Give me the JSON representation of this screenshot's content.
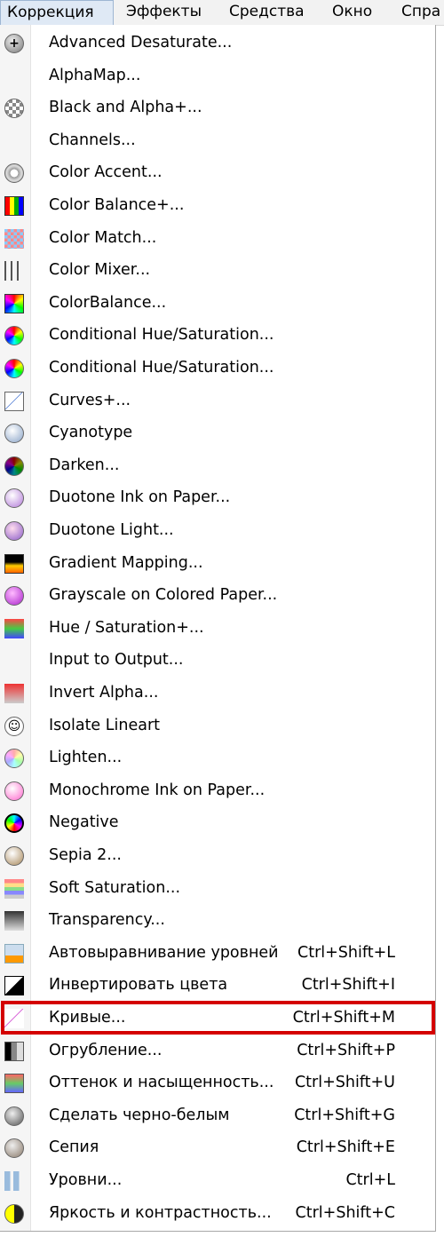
{
  "menubar": [
    {
      "label": "Коррекция",
      "active": true
    },
    {
      "label": "Эффекты",
      "active": false
    },
    {
      "label": "Средства",
      "active": false
    },
    {
      "label": "Окно",
      "active": false
    },
    {
      "label": "Спра",
      "active": false
    }
  ],
  "items": [
    {
      "label": "Advanced Desaturate...",
      "shortcut": "",
      "icon": "gray-plus-circle-icon"
    },
    {
      "label": "AlphaMap...",
      "shortcut": "",
      "icon": ""
    },
    {
      "label": "Black and Alpha+...",
      "shortcut": "",
      "icon": "checkered-circle-icon"
    },
    {
      "label": "Channels...",
      "shortcut": "",
      "icon": ""
    },
    {
      "label": "Color Accent...",
      "shortcut": "",
      "icon": "gray-ring-icon"
    },
    {
      "label": "Color Balance+...",
      "shortcut": "",
      "icon": "color-grid-icon"
    },
    {
      "label": "Color Match...",
      "shortcut": "",
      "icon": "color-dots-icon"
    },
    {
      "label": "Color Mixer...",
      "shortcut": "",
      "icon": "mixer-sliders-icon"
    },
    {
      "label": "ColorBalance...",
      "shortcut": "",
      "icon": "hourglass-gradient-icon"
    },
    {
      "label": "Conditional Hue/Saturation...",
      "shortcut": "",
      "icon": "color-wheel-icon"
    },
    {
      "label": "Conditional Hue/Saturation...",
      "shortcut": "",
      "icon": "color-wheel-icon"
    },
    {
      "label": "Curves+...",
      "shortcut": "",
      "icon": "curves-plus-icon"
    },
    {
      "label": "Cyanotype",
      "shortcut": "",
      "icon": "blue-gray-circle-icon"
    },
    {
      "label": "Darken...",
      "shortcut": "",
      "icon": "dark-wheel-icon"
    },
    {
      "label": "Duotone Ink on Paper...",
      "shortcut": "",
      "icon": "purple-circle-icon"
    },
    {
      "label": "Duotone Light...",
      "shortcut": "",
      "icon": "violet-circle-icon"
    },
    {
      "label": "Gradient Mapping...",
      "shortcut": "",
      "icon": "gradient-square-icon"
    },
    {
      "label": "Grayscale on Colored Paper...",
      "shortcut": "",
      "icon": "magenta-circle-icon"
    },
    {
      "label": "Hue / Saturation+...",
      "shortcut": "",
      "icon": "hue-square-icon"
    },
    {
      "label": "Input to Output...",
      "shortcut": "",
      "icon": ""
    },
    {
      "label": "Invert Alpha...",
      "shortcut": "",
      "icon": "red-fade-square-icon"
    },
    {
      "label": "Isolate Lineart",
      "shortcut": "",
      "icon": "smiley-icon"
    },
    {
      "label": "Lighten...",
      "shortcut": "",
      "icon": "light-wheel-icon"
    },
    {
      "label": "Monochrome Ink on Paper...",
      "shortcut": "",
      "icon": "pink-circle-icon"
    },
    {
      "label": "Negative",
      "shortcut": "",
      "icon": "negative-wheel-icon"
    },
    {
      "label": "Sepia 2...",
      "shortcut": "",
      "icon": "sepia-circle-icon"
    },
    {
      "label": "Soft Saturation...",
      "shortcut": "",
      "icon": "soft-stripes-icon"
    },
    {
      "label": "Transparency...",
      "shortcut": "",
      "icon": "transparency-icon"
    },
    {
      "label": "Автовыравнивание уровней",
      "shortcut": "Ctrl+Shift+L",
      "icon": "auto-level-icon"
    },
    {
      "label": "Инвертировать цвета",
      "shortcut": "Ctrl+Shift+I",
      "icon": "invert-colors-icon"
    },
    {
      "label": "Кривые...",
      "shortcut": "Ctrl+Shift+M",
      "icon": "curves-icon"
    },
    {
      "label": "Огрубление...",
      "shortcut": "Ctrl+Shift+P",
      "icon": "posterize-icon"
    },
    {
      "label": "Оттенок и насыщенность...",
      "shortcut": "Ctrl+Shift+U",
      "icon": "hue-saturation-icon"
    },
    {
      "label": "Сделать черно-белым",
      "shortcut": "Ctrl+Shift+G",
      "icon": "black-white-icon"
    },
    {
      "label": "Сепия",
      "shortcut": "Ctrl+Shift+E",
      "icon": "sepia-icon"
    },
    {
      "label": "Уровни...",
      "shortcut": "Ctrl+L",
      "icon": "levels-icon"
    },
    {
      "label": "Яркость и контрастность...",
      "shortcut": "Ctrl+Shift+C",
      "icon": "brightness-contrast-icon"
    }
  ],
  "highlighted_item": "Кривые...",
  "colors": {
    "highlight_border": "#d40000",
    "menubar_active": "#dfe9f5"
  }
}
